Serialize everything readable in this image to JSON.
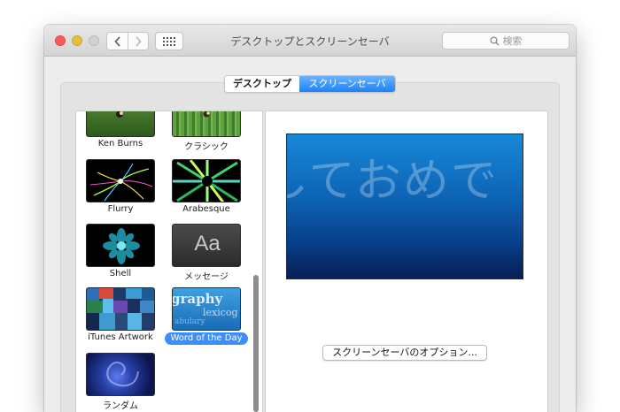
{
  "window": {
    "title": "デスクトップとスクリーンセーバ"
  },
  "search": {
    "placeholder": "検索"
  },
  "tabs": [
    {
      "label": "デスクトップ",
      "selected": false
    },
    {
      "label": "スクリーンセーバ",
      "selected": true
    }
  ],
  "savers": [
    {
      "label": "Ken Burns"
    },
    {
      "label": "クラシック"
    },
    {
      "label": "Flurry"
    },
    {
      "label": "Arabesque"
    },
    {
      "label": "Shell"
    },
    {
      "label": "メッセージ",
      "thumb_text": "Aa"
    },
    {
      "label": "iTunes Artwork"
    },
    {
      "label": "Word of the Day",
      "selected": true,
      "thumb_words": [
        "graphy",
        "lexicog",
        "abulary"
      ]
    },
    {
      "label": "ランダム"
    }
  ],
  "preview": {
    "text": "しておめで"
  },
  "options_button": {
    "label": "スクリーンセーバのオプション..."
  },
  "colors": {
    "accent": "#1b82fb",
    "selection": "#3d8ef9"
  },
  "icons": [
    "back-icon",
    "forward-icon",
    "show-all-grid-icon",
    "search-icon"
  ]
}
